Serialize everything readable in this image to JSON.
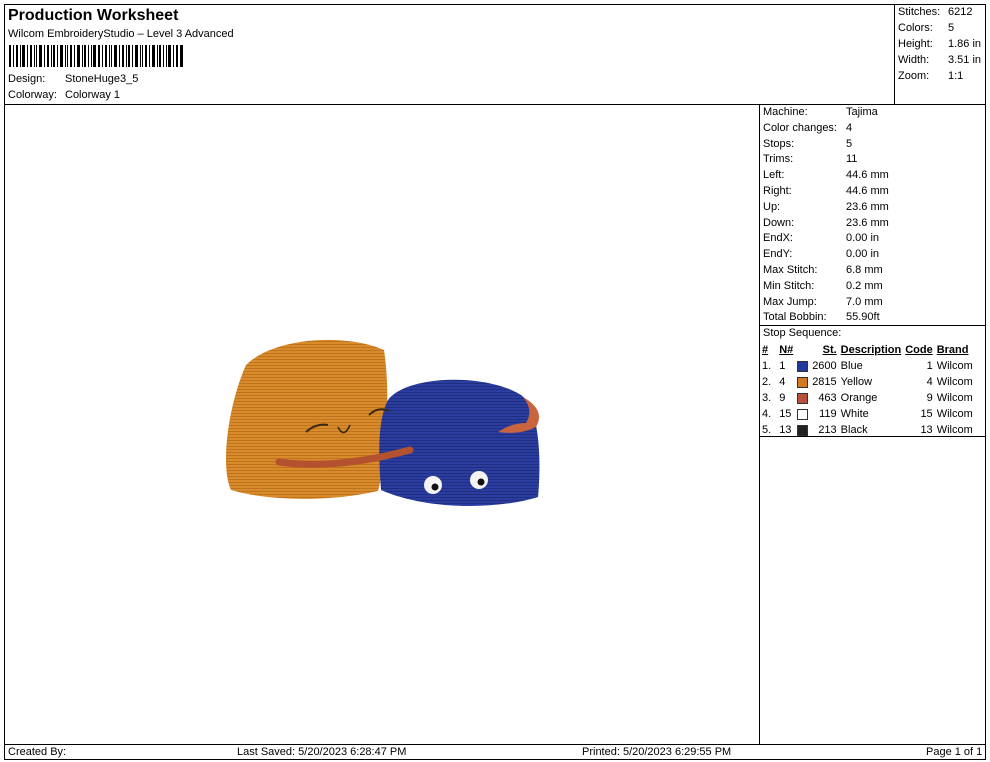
{
  "header": {
    "title": "Production Worksheet",
    "software": "Wilcom EmbroideryStudio – Level 3 Advanced",
    "design_label": "Design:",
    "design_value": "StoneHuge3_5",
    "colorway_label": "Colorway:",
    "colorway_value": "Colorway 1"
  },
  "summary": {
    "stitches_label": "Stitches:",
    "stitches_value": "6212",
    "colors_label": "Colors:",
    "colors_value": "5",
    "height_label": "Height:",
    "height_value": "1.86 in",
    "width_label": "Width:",
    "width_value": "3.51 in",
    "zoom_label": "Zoom:",
    "zoom_value": "1:1"
  },
  "machine": [
    {
      "label": "Machine:",
      "value": "Tajima"
    },
    {
      "label": "Color changes:",
      "value": "4"
    },
    {
      "label": "Stops:",
      "value": "5"
    },
    {
      "label": "Trims:",
      "value": "11"
    },
    {
      "label": "Left:",
      "value": "44.6 mm"
    },
    {
      "label": "Right:",
      "value": "44.6 mm"
    },
    {
      "label": "Up:",
      "value": "23.6 mm"
    },
    {
      "label": "Down:",
      "value": "23.6 mm"
    },
    {
      "label": "EndX:",
      "value": "0.00 in"
    },
    {
      "label": "EndY:",
      "value": "0.00 in"
    },
    {
      "label": "Max Stitch:",
      "value": "6.8 mm"
    },
    {
      "label": "Min Stitch:",
      "value": "0.2 mm"
    },
    {
      "label": "Max Jump:",
      "value": "7.0 mm"
    },
    {
      "label": "Total Bobbin:",
      "value": "55.90ft"
    }
  ],
  "stop_sequence": {
    "title": "Stop Sequence:",
    "headers": {
      "num": "#",
      "n": "N#",
      "st": "St.",
      "desc": "Description",
      "code": "Code",
      "brand": "Brand"
    },
    "rows": [
      {
        "num": "1.",
        "n": "1",
        "color": "#1f3a9a",
        "st": "2600",
        "desc": "Blue",
        "code": "1",
        "brand": "Wilcom"
      },
      {
        "num": "2.",
        "n": "4",
        "color": "#d07a26",
        "st": "2815",
        "desc": "Yellow",
        "code": "4",
        "brand": "Wilcom"
      },
      {
        "num": "3.",
        "n": "9",
        "color": "#b8503a",
        "st": "463",
        "desc": "Orange",
        "code": "9",
        "brand": "Wilcom"
      },
      {
        "num": "4.",
        "n": "15",
        "color": "#ffffff",
        "st": "119",
        "desc": "White",
        "code": "15",
        "brand": "Wilcom"
      },
      {
        "num": "5.",
        "n": "13",
        "color": "#222222",
        "st": "213",
        "desc": "Black",
        "code": "13",
        "brand": "Wilcom"
      }
    ]
  },
  "footer": {
    "created_by": "Created By:",
    "last_saved": "Last Saved: 5/20/2023 6:28:47 PM",
    "printed": "Printed: 5/20/2023 6:29:55 PM",
    "page": "Page 1 of 1"
  }
}
